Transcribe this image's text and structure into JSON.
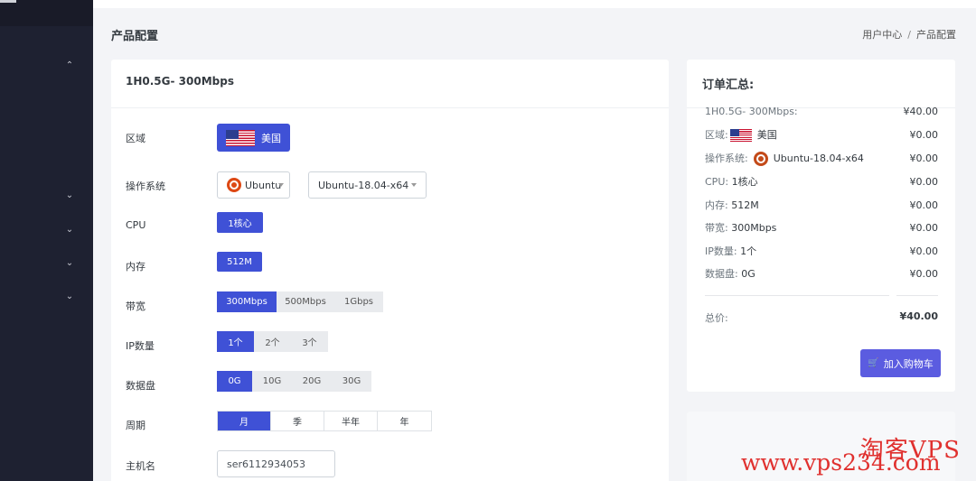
{
  "page": {
    "title": "产品配置",
    "breadcrumb": {
      "home": "用户中心",
      "separator": "/",
      "current": "产品配置"
    }
  },
  "product": {
    "name": "1H0.5G- 300Mbps",
    "labels": {
      "region": "区域",
      "os": "操作系统",
      "cpu": "CPU",
      "memory": "内存",
      "bandwidth": "带宽",
      "ip_count": "IP数量",
      "disk": "数据盘",
      "period": "周期",
      "hostname": "主机名"
    },
    "region": {
      "value": "美国",
      "flag_icon": "us-flag-icon"
    },
    "os": {
      "family": "Ubuntu",
      "version": "Ubuntu-18.04-x64",
      "icon": "ubuntu-icon"
    },
    "cpu": "1核心",
    "memory": "512M",
    "bandwidth_options": [
      "300Mbps",
      "500Mbps",
      "1Gbps"
    ],
    "bandwidth_selected": 0,
    "ip_options": [
      "1个",
      "2个",
      "3个"
    ],
    "ip_selected": 0,
    "disk_options": [
      "0G",
      "10G",
      "20G",
      "30G"
    ],
    "disk_selected": 0,
    "period_options": [
      "月",
      "季",
      "半年",
      "年"
    ],
    "period_selected": 0,
    "hostname": "ser6112934053"
  },
  "summary": {
    "title": "订单汇总:",
    "rows": [
      {
        "label": "1H0.5G- 300Mbps:",
        "value": "",
        "price": "¥40.00"
      },
      {
        "label": "区域:",
        "value": "美国",
        "price": "¥0.00"
      },
      {
        "label": "操作系统:",
        "value": "Ubuntu-18.04-x64",
        "price": "¥0.00"
      },
      {
        "label": "CPU:",
        "value": "1核心",
        "price": "¥0.00"
      },
      {
        "label": "内存:",
        "value": "512M",
        "price": "¥0.00"
      },
      {
        "label": "带宽:",
        "value": "300Mbps",
        "price": "¥0.00"
      },
      {
        "label": "IP数量:",
        "value": "1个",
        "price": "¥0.00"
      },
      {
        "label": "数据盘:",
        "value": "0G",
        "price": "¥0.00"
      }
    ],
    "total_label": "总价:",
    "total_value": "¥40.00",
    "cart_button": "加入购物车"
  },
  "watermark": {
    "cn": "淘客VPS",
    "url": "www.vps234.com"
  },
  "colors": {
    "primary": "#3f51d6",
    "cart": "#5b5ce0",
    "sidebar": "#1e2131",
    "watermark": "#e0312f"
  }
}
